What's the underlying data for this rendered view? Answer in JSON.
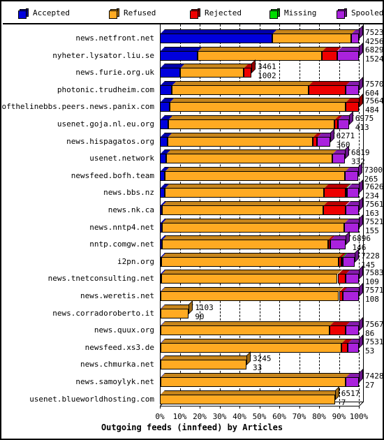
{
  "legend": {
    "items": [
      {
        "label": "Accepted",
        "color": "#0000dd"
      },
      {
        "label": "Refused",
        "color": "#ffaa22"
      },
      {
        "label": "Rejected",
        "color": "#ee0000"
      },
      {
        "label": "Missing",
        "color": "#00dd00"
      },
      {
        "label": "Spooled",
        "color": "#aa22dd"
      }
    ]
  },
  "chart_data": {
    "type": "bar",
    "orientation": "horizontal",
    "stacked": true,
    "percent_stacked": true,
    "title": "Outgoing feeds (innfeed) by Articles",
    "xlabel": "Outgoing feeds (innfeed) by Articles",
    "ylabel": "",
    "xlim": [
      0,
      100
    ],
    "xticks": [
      "0%",
      "10%",
      "20%",
      "30%",
      "40%",
      "50%",
      "60%",
      "70%",
      "80%",
      "90%",
      "100%"
    ],
    "grid": true,
    "legend_position": "top",
    "series": [
      {
        "name": "Accepted",
        "color": "#0000dd"
      },
      {
        "name": "Refused",
        "color": "#ffaa22"
      },
      {
        "name": "Rejected",
        "color": "#ee0000"
      },
      {
        "name": "Missing",
        "color": "#00dd00"
      },
      {
        "name": "Spooled",
        "color": "#aa22dd"
      }
    ],
    "categories": [
      "news.netfront.net",
      "nyheter.lysator.liu.se",
      "news.furie.org.uk",
      "photonic.trudheim.com",
      "endofthelinebbs.peers.news.panix.com",
      "usenet.goja.nl.eu.org",
      "news.hispagatos.org",
      "usenet.network",
      "newsfeed.bofh.team",
      "news.bbs.nz",
      "news.nk.ca",
      "news.nntp4.net",
      "nntp.comgw.net",
      "i2pn.org",
      "news.tnetconsulting.net",
      "news.weretis.net",
      "news.corradoroberto.it",
      "news.quux.org",
      "newsfeed.xs3.de",
      "news.chmurka.net",
      "news.samoylyk.net",
      "usenet.blueworldhosting.com"
    ],
    "rows": [
      {
        "label": "news.netfront.net",
        "total": 7523,
        "spooled": 4256,
        "bar_pct": 100.0,
        "segments": [
          56.5,
          39.5,
          0.0,
          0.0,
          4.0
        ]
      },
      {
        "label": "nyheter.lysator.liu.se",
        "total": 6829,
        "spooled": 1524,
        "bar_pct": 100.0,
        "segments": [
          19.0,
          62.5,
          7.5,
          0.0,
          11.0
        ]
      },
      {
        "label": "news.furie.org.uk",
        "total": 3461,
        "spooled": 1002,
        "bar_pct": 46.0,
        "segments": [
          10.0,
          32.0,
          4.0,
          0.0,
          0.0
        ]
      },
      {
        "label": "photonic.trudheim.com",
        "total": 7570,
        "spooled": 604,
        "bar_pct": 100.0,
        "segments": [
          5.8,
          69.0,
          18.5,
          0.0,
          6.7
        ]
      },
      {
        "label": "endofthelinebbs.peers.news.panix.com",
        "total": 7564,
        "spooled": 484,
        "bar_pct": 100.0,
        "segments": [
          4.8,
          88.5,
          6.7,
          0.0,
          0.0
        ]
      },
      {
        "label": "usenet.goja.nl.eu.org",
        "total": 6975,
        "spooled": 413,
        "bar_pct": 95.0,
        "segments": [
          4.2,
          83.5,
          1.8,
          0.0,
          5.5
        ]
      },
      {
        "label": "news.hispagatos.org",
        "total": 6271,
        "spooled": 360,
        "bar_pct": 85.5,
        "segments": [
          4.0,
          73.0,
          2.0,
          0.0,
          6.5
        ]
      },
      {
        "label": "usenet.network",
        "total": 6819,
        "spooled": 332,
        "bar_pct": 93.0,
        "segments": [
          3.0,
          83.5,
          0.0,
          0.0,
          6.5
        ]
      },
      {
        "label": "newsfeed.bofh.team",
        "total": 7300,
        "spooled": 265,
        "bar_pct": 99.5,
        "segments": [
          2.5,
          90.5,
          0.0,
          0.0,
          6.5
        ]
      },
      {
        "label": "news.bbs.nz",
        "total": 7626,
        "spooled": 234,
        "bar_pct": 100.0,
        "segments": [
          2.5,
          80.0,
          11.0,
          0.5,
          6.0
        ]
      },
      {
        "label": "news.nk.ca",
        "total": 7561,
        "spooled": 163,
        "bar_pct": 100.0,
        "segments": [
          1.2,
          81.0,
          11.0,
          0.0,
          6.8
        ]
      },
      {
        "label": "news.nntp4.net",
        "total": 7521,
        "spooled": 155,
        "bar_pct": 100.0,
        "segments": [
          1.2,
          91.5,
          0.0,
          0.0,
          7.3
        ]
      },
      {
        "label": "nntp.comgw.net",
        "total": 6896,
        "spooled": 146,
        "bar_pct": 93.5,
        "segments": [
          1.0,
          83.5,
          1.0,
          0.0,
          8.0
        ]
      },
      {
        "label": "i2pn.org",
        "total": 7228,
        "spooled": 145,
        "bar_pct": 98.0,
        "segments": [
          0.8,
          89.0,
          1.4,
          0.6,
          6.2
        ]
      },
      {
        "label": "news.tnetconsulting.net",
        "total": 7583,
        "spooled": 109,
        "bar_pct": 100.0,
        "segments": [
          0.8,
          88.5,
          4.0,
          0.0,
          6.7
        ]
      },
      {
        "label": "news.weretis.net",
        "total": 7571,
        "spooled": 108,
        "bar_pct": 100.0,
        "segments": [
          0.5,
          89.5,
          2.0,
          0.0,
          8.0
        ]
      },
      {
        "label": "news.corradoroberto.it",
        "total": 1103,
        "spooled": 90,
        "bar_pct": 14.5,
        "segments": [
          0.4,
          14.1,
          0.0,
          0.0,
          0.0
        ]
      },
      {
        "label": "news.quux.org",
        "total": 7567,
        "spooled": 86,
        "bar_pct": 100.0,
        "segments": [
          0.4,
          85.0,
          8.0,
          0.0,
          6.6
        ]
      },
      {
        "label": "newsfeed.xs3.de",
        "total": 7531,
        "spooled": 53,
        "bar_pct": 100.0,
        "segments": [
          0.3,
          91.0,
          3.0,
          0.0,
          5.7
        ]
      },
      {
        "label": "news.chmurka.net",
        "total": 3245,
        "spooled": 33,
        "bar_pct": 43.5,
        "segments": [
          0.2,
          43.3,
          0.0,
          0.0,
          0.0
        ]
      },
      {
        "label": "news.samoylyk.net",
        "total": 7428,
        "spooled": 27,
        "bar_pct": 100.0,
        "segments": [
          0.2,
          93.3,
          0.0,
          0.0,
          6.5
        ]
      },
      {
        "label": "usenet.blueworldhosting.com",
        "total": 6517,
        "spooled": 7,
        "bar_pct": 88.0,
        "segments": [
          0.1,
          87.9,
          0.0,
          0.0,
          0.0
        ]
      }
    ]
  }
}
